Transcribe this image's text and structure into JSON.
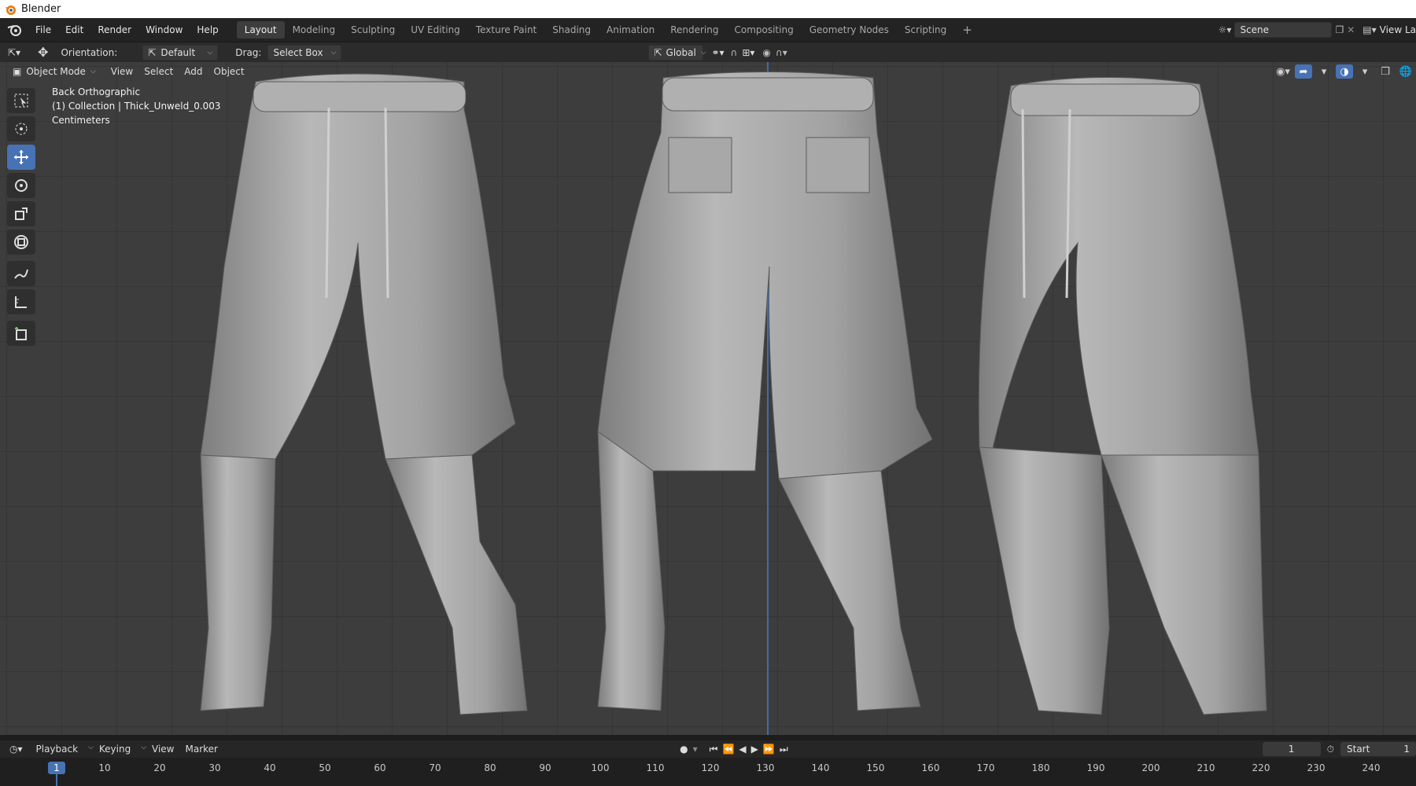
{
  "window_title": "Blender",
  "menu": [
    "File",
    "Edit",
    "Render",
    "Window",
    "Help"
  ],
  "workspaces": [
    "Layout",
    "Modeling",
    "Sculpting",
    "UV Editing",
    "Texture Paint",
    "Shading",
    "Animation",
    "Rendering",
    "Compositing",
    "Geometry Nodes",
    "Scripting"
  ],
  "active_workspace": "Layout",
  "scene": {
    "name": "Scene",
    "view_layer": "View La"
  },
  "tool_header": {
    "orientation_label": "Orientation:",
    "orientation_value": "Default",
    "drag_label": "Drag:",
    "drag_value": "Select Box",
    "transform_orientation": "Global"
  },
  "viewport_header": {
    "mode": "Object Mode",
    "menus": [
      "View",
      "Select",
      "Add",
      "Object"
    ]
  },
  "viewport_overlay": {
    "view_name": "Back Orthographic",
    "collection_line": "(1) Collection | Thick_Unweld_0.003",
    "units": "Centimeters"
  },
  "toolbar_tools": [
    {
      "name": "select-box-icon",
      "active": false
    },
    {
      "name": "cursor-icon",
      "active": false
    },
    {
      "name": "move-icon",
      "active": true
    },
    {
      "name": "rotate-icon",
      "active": false
    },
    {
      "name": "scale-icon",
      "active": false
    },
    {
      "name": "transform-icon",
      "active": false
    },
    {
      "name": "annotate-icon",
      "active": false
    },
    {
      "name": "measure-icon",
      "active": false
    },
    {
      "name": "add-cube-icon",
      "active": false
    }
  ],
  "timeline": {
    "menus": [
      "Playback",
      "Keying",
      "View",
      "Marker"
    ],
    "current_frame": "1",
    "start_label": "Start",
    "start_value": "1",
    "ticks": [
      "10",
      "20",
      "30",
      "40",
      "50",
      "60",
      "70",
      "80",
      "90",
      "100",
      "110",
      "120",
      "130",
      "140",
      "150",
      "160",
      "170",
      "180",
      "190",
      "200",
      "210",
      "220",
      "230",
      "240"
    ]
  },
  "colors": {
    "accent": "#4772b3",
    "viewport_bg": "#3d3d3d",
    "mesh": "#a8a8a8"
  }
}
